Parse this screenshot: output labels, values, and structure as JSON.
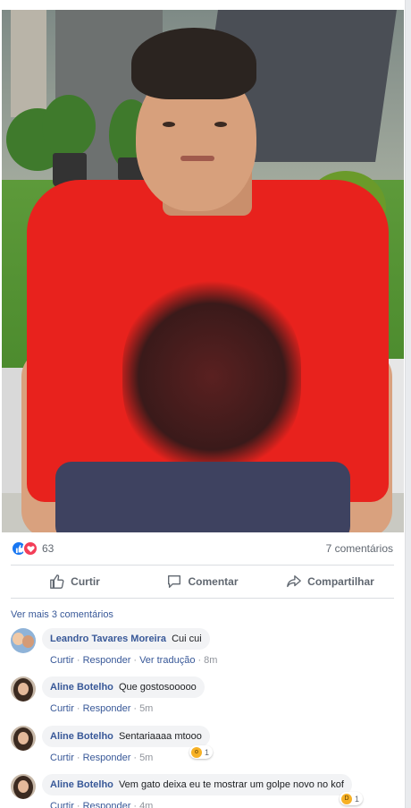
{
  "post": {
    "photo_alt": "",
    "reaction_count": "63",
    "comments_count": "7 comentários",
    "reaction_icons": [
      "like-icon",
      "love-icon"
    ],
    "accent_color": "#385898"
  },
  "actions": {
    "like_label": "Curtir",
    "comment_label": "Comentar",
    "share_label": "Compartilhar"
  },
  "more_comments": "Ver mais 3 comentários",
  "comments": [
    {
      "author": "Leandro Tavares Moreira",
      "text": "Cui cui",
      "reply_like": "Curtir",
      "reply": "Responder",
      "translate": "Ver tradução",
      "time": "8m"
    },
    {
      "author": "Aline Botelho",
      "text": "Que gostosooooo",
      "reply_like": "Curtir",
      "reply": "Responder",
      "time": "5m"
    },
    {
      "author": "Aline Botelho",
      "text": "Sentariaaaa mtooo",
      "reply_like": "Curtir",
      "reply": "Responder",
      "time": "5m",
      "reaction_count": "1",
      "reaction_icon": "wow-icon"
    },
    {
      "author": "Aline Botelho",
      "text": "Vem gato deixa eu te mostrar um golpe novo no kof",
      "reply_like": "Curtir",
      "reply": "Responder",
      "time": "4m",
      "reaction_count": "1",
      "reaction_icon": "haha-icon"
    }
  ]
}
